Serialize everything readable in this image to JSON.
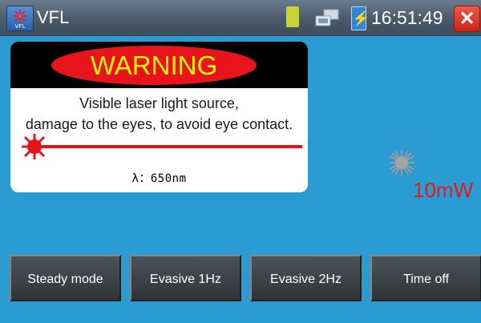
{
  "titlebar": {
    "app_icon": "laser-burst-icon",
    "app_icon_label": "VFL",
    "title": "VFL",
    "status_icons": [
      "sd-card-icon",
      "network-icon",
      "battery-charging-icon"
    ],
    "time": "16:51:49",
    "close_icon": "close-icon"
  },
  "warning": {
    "heading": "WARNING",
    "line1": "Visible laser light source,",
    "line2": "damage to the eyes, to avoid eye contact.",
    "wavelength": "λ：650nm"
  },
  "power": {
    "value": "10mW"
  },
  "buttons": {
    "steady": "Steady mode",
    "evasive1": "Evasive 1Hz",
    "evasive2": "Evasive 2Hz",
    "timeoff": "Time off"
  },
  "colors": {
    "background": "#2b9bd3",
    "warning_red": "#e8141b",
    "warning_yellow": "#fff200",
    "power_text": "#e51a1a"
  }
}
